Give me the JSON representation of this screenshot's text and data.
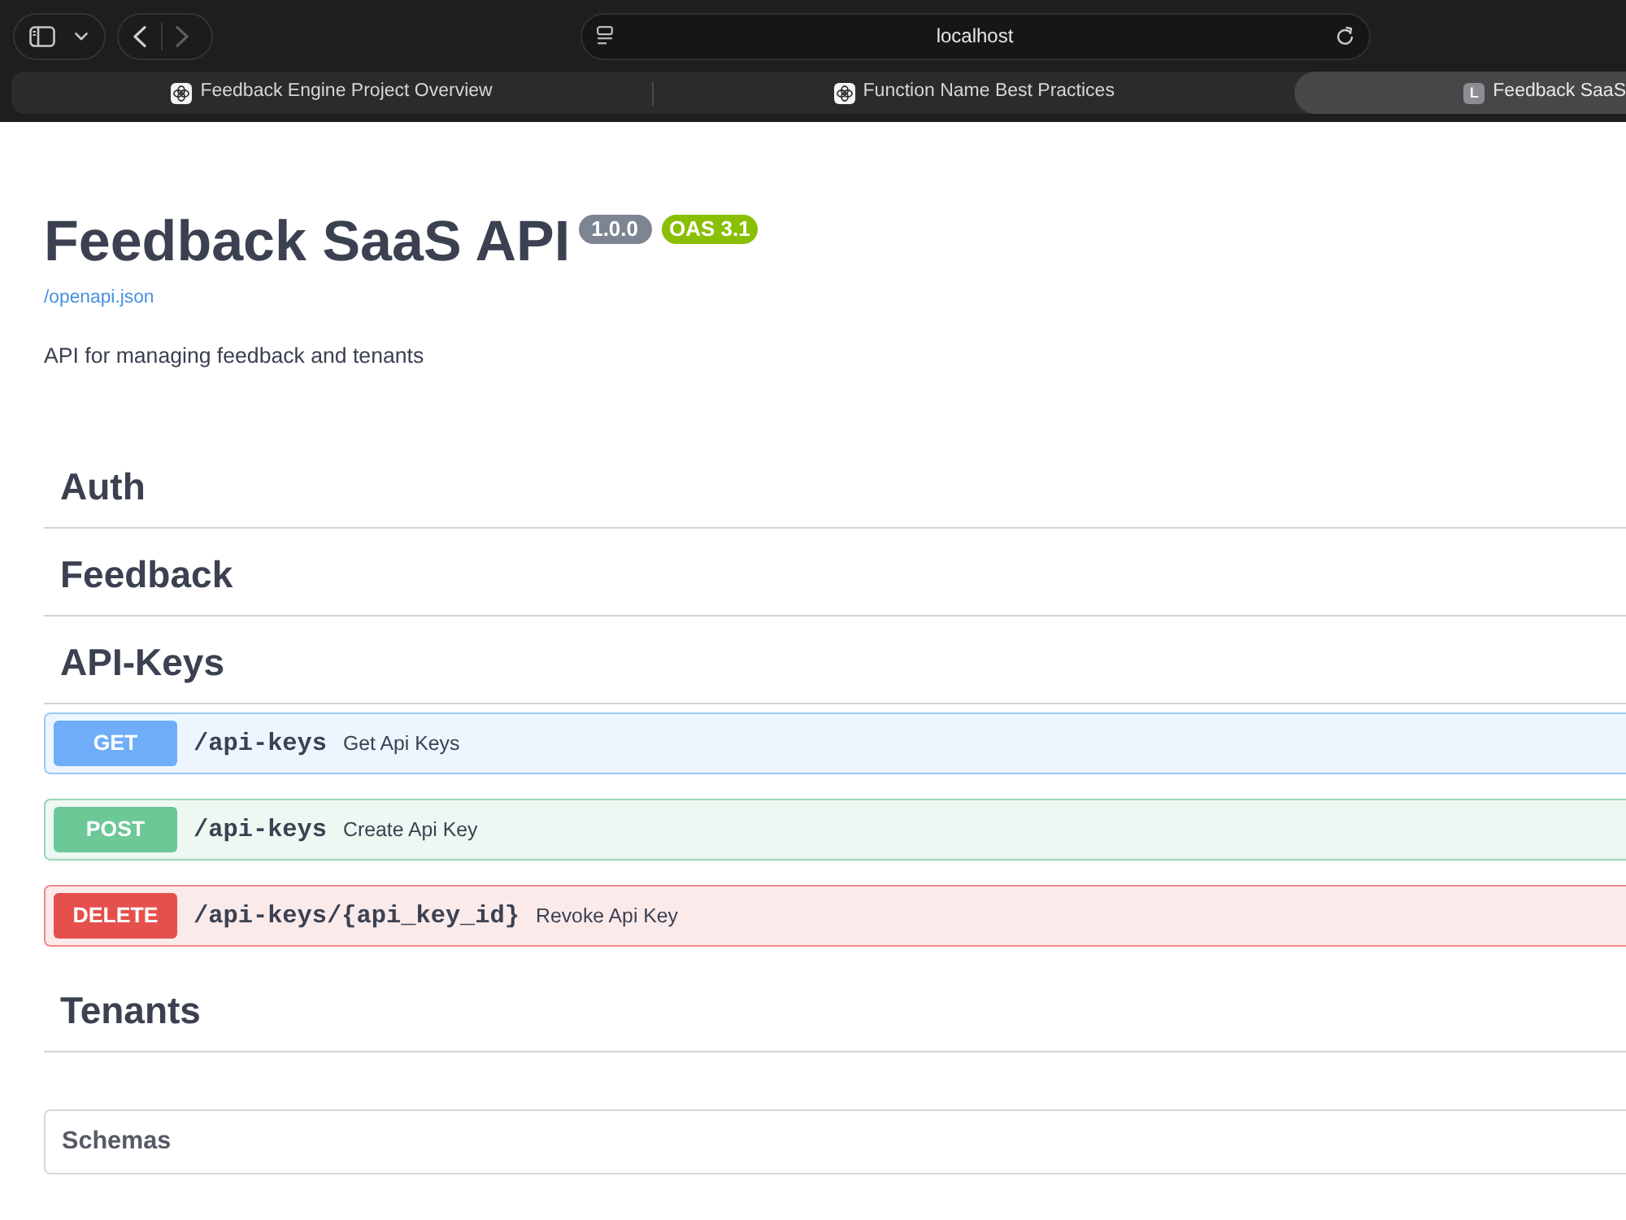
{
  "browser": {
    "back": {
      "disabled": false
    },
    "forward": {
      "disabled": true
    },
    "address": "localhost",
    "tabs": [
      {
        "title": "Feedback Engine Project Overview",
        "kind": "logo",
        "selected": false
      },
      {
        "title": "Function Name Best Practices",
        "kind": "logo",
        "selected": false
      },
      {
        "title": "Feedback SaaS",
        "kind": "letter",
        "letter": "L",
        "selected": true
      }
    ]
  },
  "info": {
    "title": "Feedback SaaS API",
    "version": "1.0.0",
    "oas": "OAS 3.1",
    "spec_link": "/openapi.json",
    "description": "API for managing feedback and tenants"
  },
  "sections": [
    {
      "name": "Auth"
    },
    {
      "name": "Feedback"
    },
    {
      "name": "API-Keys",
      "operations": [
        {
          "kind": "get",
          "method": "GET",
          "path": "/api-keys",
          "summary": "Get Api Keys"
        },
        {
          "kind": "post",
          "method": "POST",
          "path": "/api-keys",
          "summary": "Create Api Key"
        },
        {
          "kind": "delete",
          "method": "DELETE",
          "path": "/api-keys/{api_key_id}",
          "summary": "Revoke Api Key"
        }
      ]
    },
    {
      "name": "Tenants"
    }
  ],
  "schemas": {
    "title": "Schemas"
  }
}
